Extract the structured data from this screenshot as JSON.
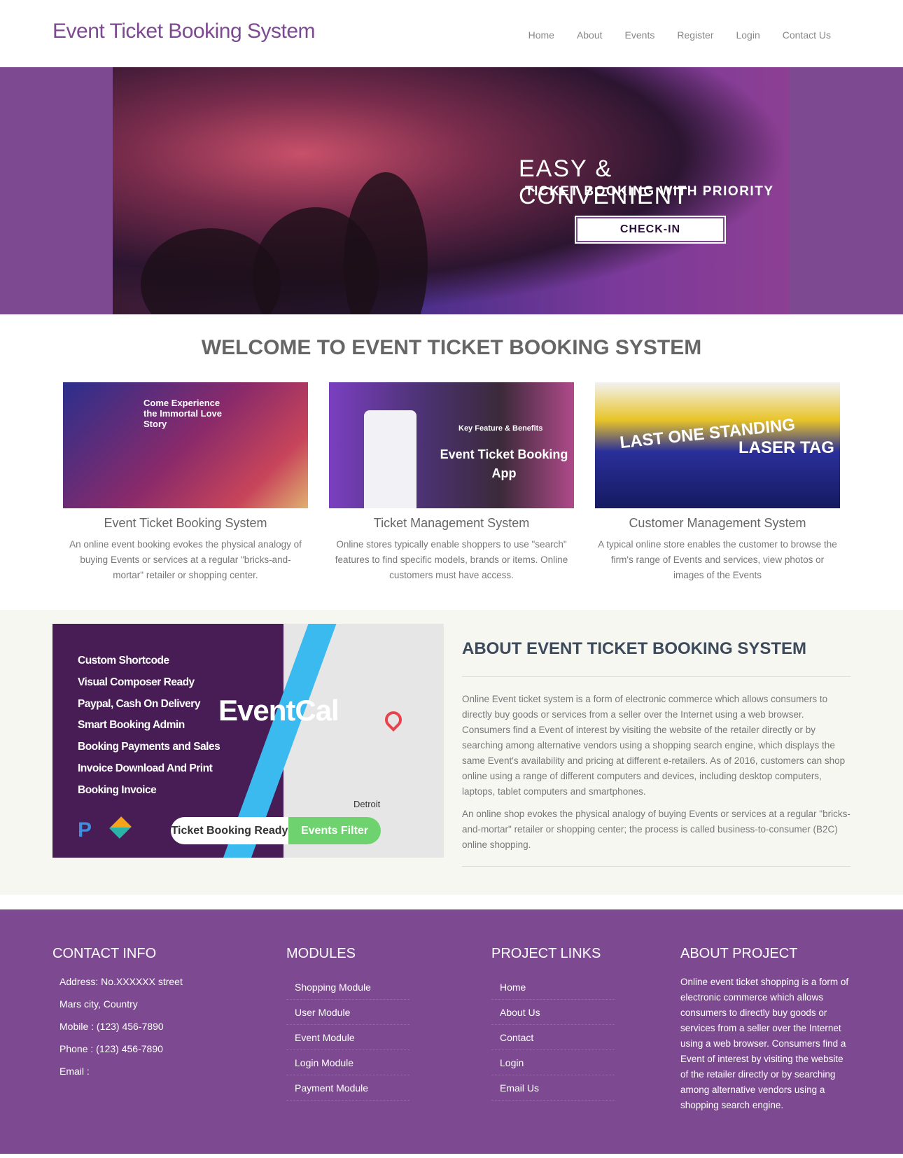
{
  "header": {
    "title": "Event Ticket Booking System",
    "nav": [
      "Home",
      "About",
      "Events",
      "Register",
      "Login",
      "Contact Us"
    ]
  },
  "banner": {
    "line1": "EASY & CONVENIENT",
    "line2": "TICKET BOOKING WITH PRIORITY",
    "button": "CHECK-IN"
  },
  "welcome": {
    "heading": "WELCOME TO EVENT TICKET BOOKING SYSTEM",
    "cards": [
      {
        "title": "Event Ticket Booking System",
        "text": "An online event booking evokes the physical analogy of buying Events or services at a regular \"bricks-and-mortar\" retailer or shopping center.",
        "image_text": "Come Experience the Immortal Love Story"
      },
      {
        "title": "Ticket Management System",
        "text": "Online stores typically enable shoppers to use \"search\" features to find specific models, brands or items. Online customers must have access.",
        "image_text": "Key Feature & Benefits",
        "image_text2": "Event Ticket Booking App"
      },
      {
        "title": "Customer Management System",
        "text": "A typical online store enables the customer to browse the firm's range of Events and services, view photos or images of the Events",
        "image_text": "LAST ONE STANDING",
        "image_text2": "LASER TAG"
      }
    ]
  },
  "about": {
    "image": {
      "features": [
        "Custom Shortcode",
        "Visual Composer Ready",
        "Paypal, Cash On Delivery",
        "Smart Booking Admin",
        "Booking Payments and Sales",
        "Invoice Download And Print",
        "Booking Invoice"
      ],
      "logo": "EventCal",
      "pill_left": "Ticket Booking Ready",
      "pill_right": "Events Filter",
      "map_label": "Detroit"
    },
    "heading": "ABOUT EVENT TICKET BOOKING SYSTEM",
    "paragraphs": [
      "Online Event ticket system is a form of electronic commerce which allows consumers to directly buy goods or services from a seller over the Internet using a web browser. Consumers find a Event of interest by visiting the website of the retailer directly or by searching among alternative vendors using a shopping search engine, which displays the same Event's availability and pricing at different e-retailers. As of 2016, customers can shop online using a range of different computers and devices, including desktop computers, laptops, tablet computers and smartphones.",
      "An online shop evokes the physical analogy of buying Events or services at a regular \"bricks-and-mortar\" retailer or shopping center; the process is called business-to-consumer (B2C) online shopping."
    ]
  },
  "footer": {
    "contact": {
      "heading": "CONTACT INFO",
      "lines": [
        "Address: No.XXXXXX street",
        "Mars city, Country",
        "Mobile : (123) 456-7890",
        "Phone : (123) 456-7890",
        "Email :"
      ]
    },
    "modules": {
      "heading": "MODULES",
      "items": [
        "Shopping Module",
        "User Module",
        "Event Module",
        "Login Module",
        "Payment Module"
      ]
    },
    "links": {
      "heading": "PROJECT LINKS",
      "items": [
        "Home",
        "About Us",
        "Contact",
        "Login",
        "Email Us"
      ]
    },
    "about": {
      "heading": "ABOUT PROJECT",
      "text": "Online event ticket shopping is a form of electronic commerce which allows consumers to directly buy goods or services from a seller over the Internet using a web browser. Consumers find a Event of interest by visiting the website of the retailer directly or by searching among alternative vendors using a shopping search engine."
    }
  },
  "colors": {
    "brand": "#7d4a91",
    "about_bg": "#f7f7f2"
  }
}
